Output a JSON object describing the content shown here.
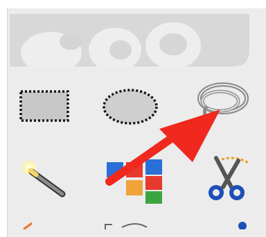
{
  "panel": {
    "name": "toolbox"
  },
  "tools": [
    {
      "id": "rect-select",
      "icon": "rect-select-icon",
      "row": 1,
      "col": 1
    },
    {
      "id": "ellipse-select",
      "icon": "ellipse-select-icon",
      "row": 1,
      "col": 2
    },
    {
      "id": "free-select",
      "icon": "lasso-icon",
      "row": 1,
      "col": 3
    },
    {
      "id": "fuzzy-select",
      "icon": "magic-wand-icon",
      "row": 2,
      "col": 1
    },
    {
      "id": "select-by-color",
      "icon": "color-select-icon",
      "row": 2,
      "col": 2
    },
    {
      "id": "scissors-select",
      "icon": "scissors-icon",
      "row": 2,
      "col": 3
    }
  ],
  "annotation": {
    "type": "arrow",
    "color": "#f0281e",
    "points_to": "free-select"
  },
  "colors": {
    "toolbox_bg": "#ececec",
    "wilber": "#d9d9d9",
    "accent_red": "#f0281e"
  }
}
